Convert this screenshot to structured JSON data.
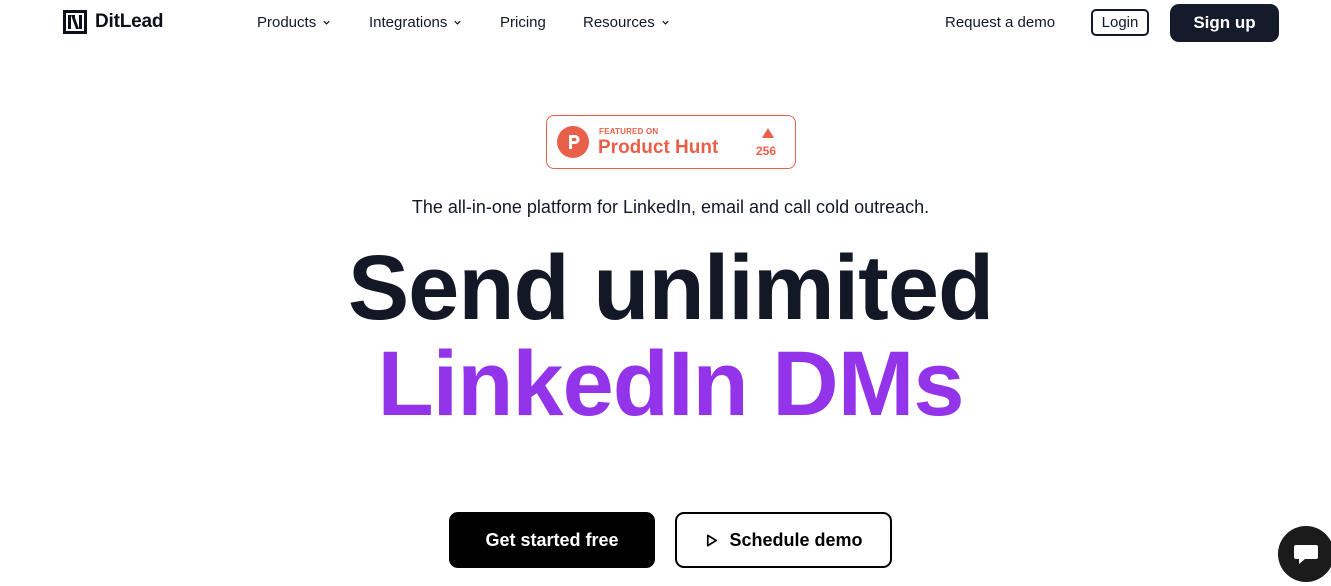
{
  "brand": {
    "name": "DitLead",
    "logo_icon": "ditlead-logo-icon"
  },
  "nav": {
    "items": [
      {
        "label": "Products",
        "has_dropdown": true
      },
      {
        "label": "Integrations",
        "has_dropdown": true
      },
      {
        "label": "Pricing",
        "has_dropdown": false
      },
      {
        "label": "Resources",
        "has_dropdown": true
      }
    ],
    "request_demo": "Request a demo",
    "login": "Login",
    "signup": "Sign up"
  },
  "badge": {
    "featured_on": "FEATURED ON",
    "name": "Product Hunt",
    "upvotes": "256",
    "icon": "product-hunt-icon",
    "color": "#e9604a"
  },
  "hero": {
    "tagline": "The all-in-one platform for LinkedIn, email and call cold outreach.",
    "headline_line1": "Send unlimited",
    "headline_line2": "LinkedIn DMs",
    "headline_color": "#121826",
    "accent_color": "#9334ea"
  },
  "cta": {
    "primary": "Get started free",
    "secondary": "Schedule demo",
    "secondary_icon": "play-icon"
  },
  "chat": {
    "icon": "chat-bubble-icon"
  }
}
